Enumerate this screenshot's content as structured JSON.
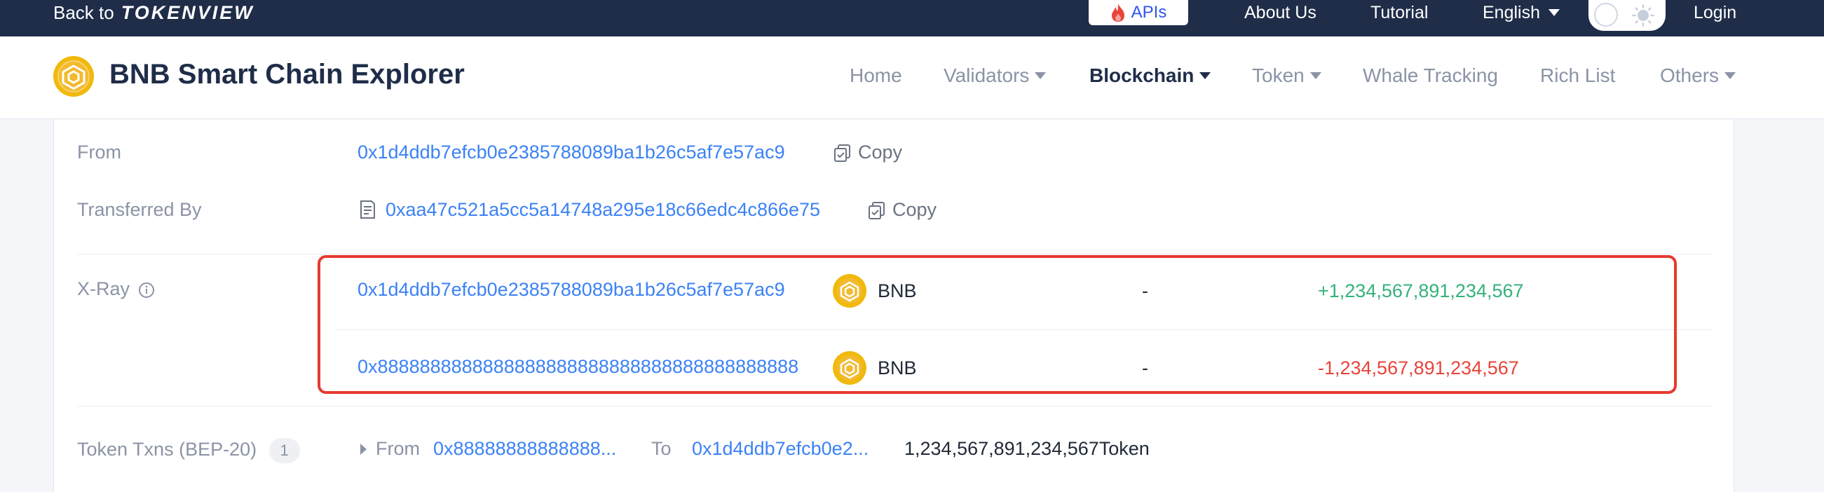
{
  "topbar": {
    "back_prefix": "Back to",
    "back_brand": "TOKENVIEW",
    "apis_label": "APIs",
    "about": "About Us",
    "tutorial": "Tutorial",
    "language": "English",
    "login": "Login"
  },
  "header": {
    "title": "BNB Smart Chain Explorer",
    "nav": {
      "home": "Home",
      "validators": "Validators",
      "blockchain": "Blockchain",
      "token": "Token",
      "whale": "Whale Tracking",
      "rich": "Rich List",
      "others": "Others"
    }
  },
  "details": {
    "from_label": "From",
    "from_address": "0x1d4ddb7efcb0e2385788089ba1b26c5af7e57ac9",
    "copy_label": "Copy",
    "transferred_label": "Transferred By",
    "transferred_address": "0xaa47c521a5cc5a14748a295e18c66edc4c866e75",
    "xray_label": "X-Ray",
    "xray_rows": [
      {
        "address": "0x1d4ddb7efcb0e2385788089ba1b26c5af7e57ac9",
        "token": "BNB",
        "dash": "-",
        "amount": "+1,234,567,891,234,567"
      },
      {
        "address": "0x8888888888888888888888888888888888888888",
        "token": "BNB",
        "dash": "-",
        "amount": "-1,234,567,891,234,567"
      }
    ],
    "token_txns_label": "Token Txns (BEP-20)",
    "token_txns_count": "1",
    "txn": {
      "from_label": "From",
      "from_addr": "0x88888888888888...",
      "to_label": "To",
      "to_addr": "0x1d4ddb7efcb0e2...",
      "amount": "1,234,567,891,234,567Token"
    }
  },
  "colors": {
    "topbar_bg": "#1f2d49",
    "link": "#3b82f6",
    "positive": "#34b27b",
    "negative": "#e8443a",
    "highlight_border": "#e53b2f",
    "bnb_gold": "#f0b90b"
  }
}
